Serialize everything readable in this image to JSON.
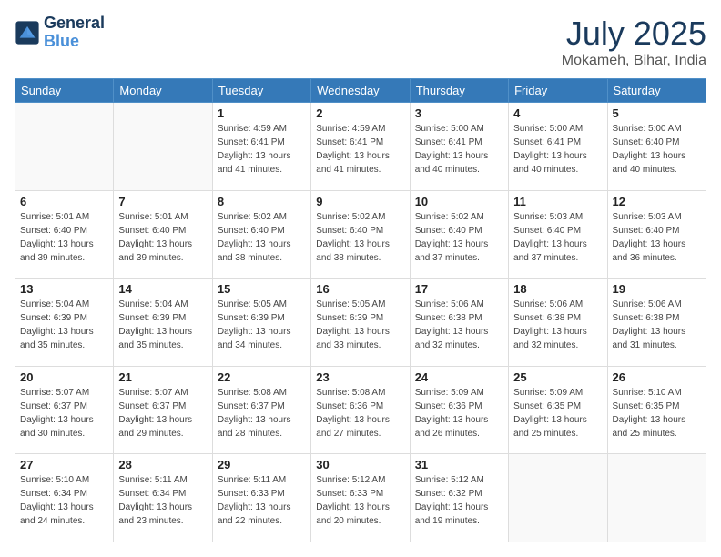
{
  "header": {
    "logo_line1": "General",
    "logo_line2": "Blue",
    "month": "July 2025",
    "location": "Mokameh, Bihar, India"
  },
  "weekdays": [
    "Sunday",
    "Monday",
    "Tuesday",
    "Wednesday",
    "Thursday",
    "Friday",
    "Saturday"
  ],
  "weeks": [
    [
      {
        "day": "",
        "info": ""
      },
      {
        "day": "",
        "info": ""
      },
      {
        "day": "1",
        "info": "Sunrise: 4:59 AM\nSunset: 6:41 PM\nDaylight: 13 hours and 41 minutes."
      },
      {
        "day": "2",
        "info": "Sunrise: 4:59 AM\nSunset: 6:41 PM\nDaylight: 13 hours and 41 minutes."
      },
      {
        "day": "3",
        "info": "Sunrise: 5:00 AM\nSunset: 6:41 PM\nDaylight: 13 hours and 40 minutes."
      },
      {
        "day": "4",
        "info": "Sunrise: 5:00 AM\nSunset: 6:41 PM\nDaylight: 13 hours and 40 minutes."
      },
      {
        "day": "5",
        "info": "Sunrise: 5:00 AM\nSunset: 6:40 PM\nDaylight: 13 hours and 40 minutes."
      }
    ],
    [
      {
        "day": "6",
        "info": "Sunrise: 5:01 AM\nSunset: 6:40 PM\nDaylight: 13 hours and 39 minutes."
      },
      {
        "day": "7",
        "info": "Sunrise: 5:01 AM\nSunset: 6:40 PM\nDaylight: 13 hours and 39 minutes."
      },
      {
        "day": "8",
        "info": "Sunrise: 5:02 AM\nSunset: 6:40 PM\nDaylight: 13 hours and 38 minutes."
      },
      {
        "day": "9",
        "info": "Sunrise: 5:02 AM\nSunset: 6:40 PM\nDaylight: 13 hours and 38 minutes."
      },
      {
        "day": "10",
        "info": "Sunrise: 5:02 AM\nSunset: 6:40 PM\nDaylight: 13 hours and 37 minutes."
      },
      {
        "day": "11",
        "info": "Sunrise: 5:03 AM\nSunset: 6:40 PM\nDaylight: 13 hours and 37 minutes."
      },
      {
        "day": "12",
        "info": "Sunrise: 5:03 AM\nSunset: 6:40 PM\nDaylight: 13 hours and 36 minutes."
      }
    ],
    [
      {
        "day": "13",
        "info": "Sunrise: 5:04 AM\nSunset: 6:39 PM\nDaylight: 13 hours and 35 minutes."
      },
      {
        "day": "14",
        "info": "Sunrise: 5:04 AM\nSunset: 6:39 PM\nDaylight: 13 hours and 35 minutes."
      },
      {
        "day": "15",
        "info": "Sunrise: 5:05 AM\nSunset: 6:39 PM\nDaylight: 13 hours and 34 minutes."
      },
      {
        "day": "16",
        "info": "Sunrise: 5:05 AM\nSunset: 6:39 PM\nDaylight: 13 hours and 33 minutes."
      },
      {
        "day": "17",
        "info": "Sunrise: 5:06 AM\nSunset: 6:38 PM\nDaylight: 13 hours and 32 minutes."
      },
      {
        "day": "18",
        "info": "Sunrise: 5:06 AM\nSunset: 6:38 PM\nDaylight: 13 hours and 32 minutes."
      },
      {
        "day": "19",
        "info": "Sunrise: 5:06 AM\nSunset: 6:38 PM\nDaylight: 13 hours and 31 minutes."
      }
    ],
    [
      {
        "day": "20",
        "info": "Sunrise: 5:07 AM\nSunset: 6:37 PM\nDaylight: 13 hours and 30 minutes."
      },
      {
        "day": "21",
        "info": "Sunrise: 5:07 AM\nSunset: 6:37 PM\nDaylight: 13 hours and 29 minutes."
      },
      {
        "day": "22",
        "info": "Sunrise: 5:08 AM\nSunset: 6:37 PM\nDaylight: 13 hours and 28 minutes."
      },
      {
        "day": "23",
        "info": "Sunrise: 5:08 AM\nSunset: 6:36 PM\nDaylight: 13 hours and 27 minutes."
      },
      {
        "day": "24",
        "info": "Sunrise: 5:09 AM\nSunset: 6:36 PM\nDaylight: 13 hours and 26 minutes."
      },
      {
        "day": "25",
        "info": "Sunrise: 5:09 AM\nSunset: 6:35 PM\nDaylight: 13 hours and 25 minutes."
      },
      {
        "day": "26",
        "info": "Sunrise: 5:10 AM\nSunset: 6:35 PM\nDaylight: 13 hours and 25 minutes."
      }
    ],
    [
      {
        "day": "27",
        "info": "Sunrise: 5:10 AM\nSunset: 6:34 PM\nDaylight: 13 hours and 24 minutes."
      },
      {
        "day": "28",
        "info": "Sunrise: 5:11 AM\nSunset: 6:34 PM\nDaylight: 13 hours and 23 minutes."
      },
      {
        "day": "29",
        "info": "Sunrise: 5:11 AM\nSunset: 6:33 PM\nDaylight: 13 hours and 22 minutes."
      },
      {
        "day": "30",
        "info": "Sunrise: 5:12 AM\nSunset: 6:33 PM\nDaylight: 13 hours and 20 minutes."
      },
      {
        "day": "31",
        "info": "Sunrise: 5:12 AM\nSunset: 6:32 PM\nDaylight: 13 hours and 19 minutes."
      },
      {
        "day": "",
        "info": ""
      },
      {
        "day": "",
        "info": ""
      }
    ]
  ]
}
